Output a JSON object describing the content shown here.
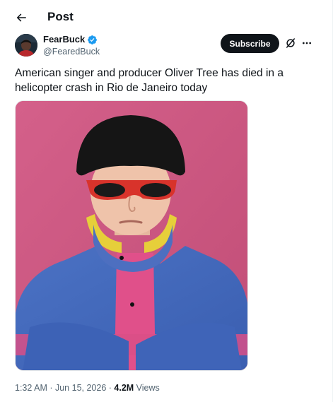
{
  "header": {
    "title": "Post",
    "back_icon": "arrow-left-icon"
  },
  "author": {
    "display_name": "FearBuck",
    "handle": "@FearedBuck",
    "verified": true,
    "verified_color": "#1d9bf0"
  },
  "actions": {
    "subscribe_label": "Subscribe",
    "grok_icon": "grok-icon",
    "more_icon": "more-horizontal-icon"
  },
  "tweet": {
    "text": "American singer and producer Oliver Tree has died in a helicopter crash in Rio de Janeiro today"
  },
  "meta": {
    "time": "1:32 AM",
    "separator": " · ",
    "date": "Jun 15, 2026",
    "views_count": "4.2M",
    "views_label": "Views"
  },
  "colors": {
    "text_primary": "#0f1419",
    "text_secondary": "#536471",
    "photo_background": "#cf5d83"
  }
}
